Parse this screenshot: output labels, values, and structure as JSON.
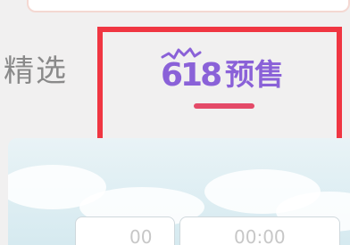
{
  "tabs": {
    "featured_label": "精选",
    "presale_number": "618",
    "presale_label": "预售"
  },
  "banner": {
    "slot_1_time": "00",
    "slot_2_time": "00:00"
  },
  "colors": {
    "presale_purple": "#8a61d8",
    "underline_red": "#e44a68",
    "highlight_red": "#f03642",
    "background": "#f1f0f0"
  }
}
